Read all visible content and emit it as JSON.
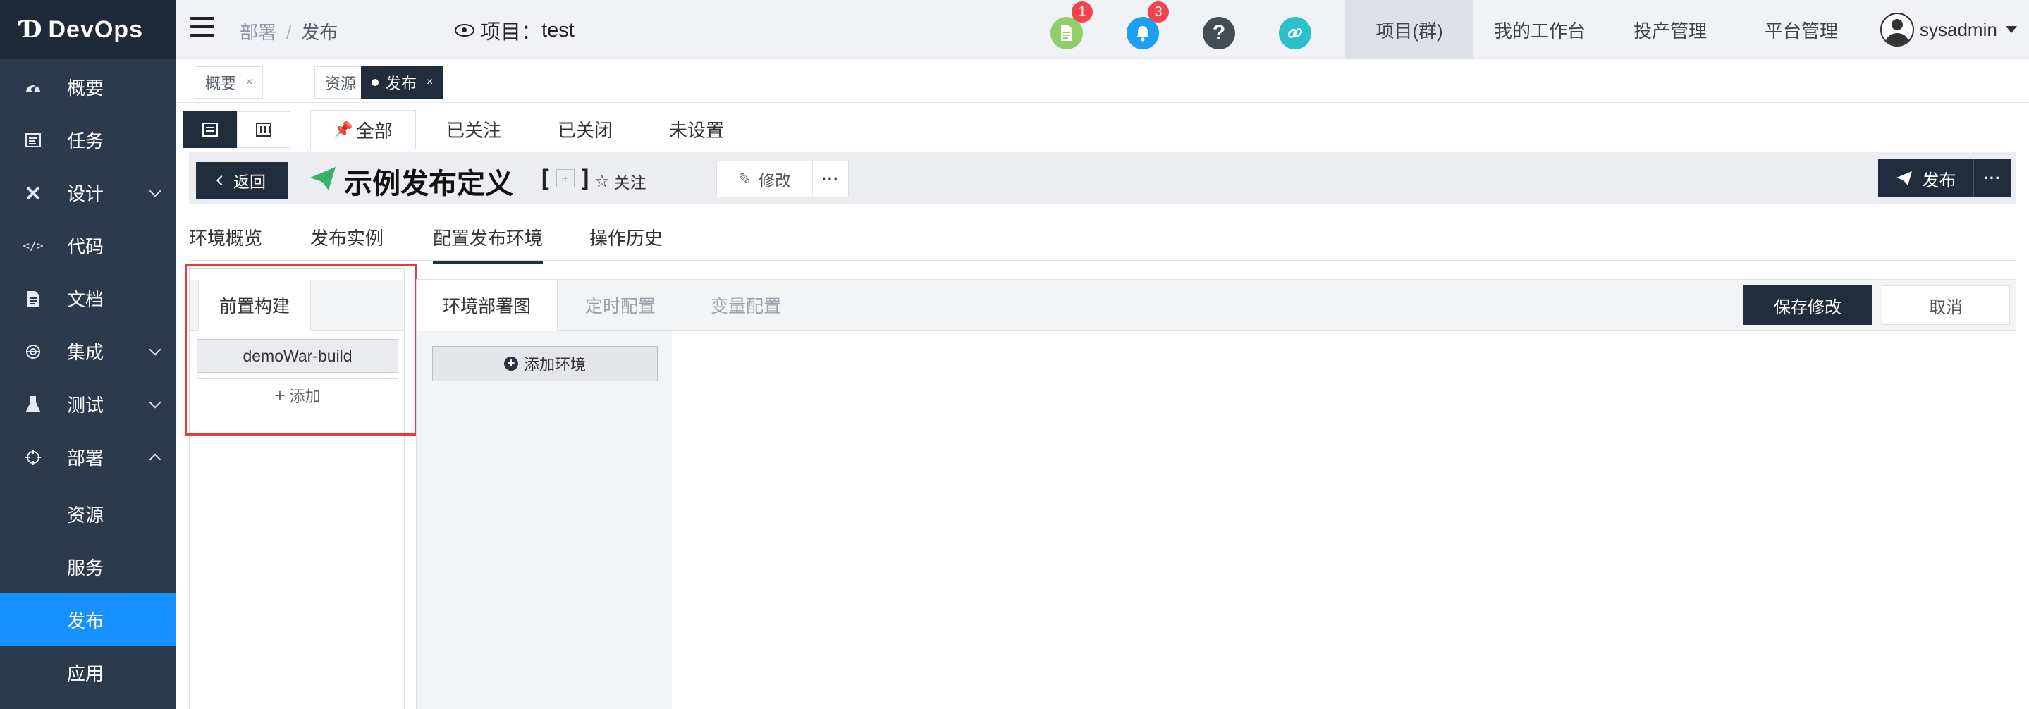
{
  "app": {
    "logo_text": "DevOps"
  },
  "sidebar": {
    "items": [
      {
        "label": "概要",
        "icon": "dashboard-icon"
      },
      {
        "label": "任务",
        "icon": "task-icon"
      },
      {
        "label": "设计",
        "icon": "design-icon",
        "expandable": true
      },
      {
        "label": "代码",
        "icon": "code-icon"
      },
      {
        "label": "文档",
        "icon": "document-icon"
      },
      {
        "label": "集成",
        "icon": "integration-icon",
        "expandable": true
      },
      {
        "label": "测试",
        "icon": "test-flask-icon",
        "expandable": true
      },
      {
        "label": "部署",
        "icon": "deploy-target-icon",
        "expanded": true
      }
    ],
    "subitems": [
      {
        "label": "资源"
      },
      {
        "label": "服务"
      },
      {
        "label": "发布",
        "active": true
      },
      {
        "label": "应用"
      }
    ]
  },
  "header": {
    "breadcrumb": [
      "部署",
      "发布"
    ],
    "breadcrumb_sep": "/",
    "project_prefix": "项目：",
    "project_name": "test",
    "icons": [
      {
        "name": "document-notice-icon",
        "color": "#8fcf6a",
        "badge": "1"
      },
      {
        "name": "bell-icon",
        "color": "#1e9ff2",
        "badge": "3"
      },
      {
        "name": "help-icon",
        "color": "#444c56",
        "glyph": "?"
      },
      {
        "name": "link-icon",
        "color": "#2bc0cc"
      }
    ],
    "menu": [
      {
        "label": "项目(群)",
        "active": true
      },
      {
        "label": "我的工作台"
      },
      {
        "label": "投产管理"
      },
      {
        "label": "平台管理"
      }
    ],
    "user": "sysadmin"
  },
  "page_tabs": [
    {
      "label": "概要"
    },
    {
      "label": "资源"
    },
    {
      "label": "发布",
      "active": true
    }
  ],
  "page_tab_close": "×",
  "filter_tabs": [
    {
      "label": "全部",
      "active": true
    },
    {
      "label": "已关注"
    },
    {
      "label": "已关闭"
    },
    {
      "label": "未设置"
    }
  ],
  "titlebar": {
    "back": "返回",
    "title": "示例发布定义",
    "bracket_open": "[",
    "bracket_plus": "+",
    "bracket_close": "]",
    "follow": "关注",
    "edit": "修改",
    "more": "···",
    "publish": "发布",
    "publish_more": "···",
    "accent_color": "#3bb26a"
  },
  "sub_tabs": [
    {
      "label": "环境概览"
    },
    {
      "label": "发布实例"
    },
    {
      "label": "配置发布环境",
      "active": true
    },
    {
      "label": "操作历史"
    }
  ],
  "left_panel": {
    "tab": "前置构建",
    "build_item": "demoWar-build",
    "add": "添加"
  },
  "right_panel": {
    "tabs": [
      {
        "label": "环境部署图",
        "active": true
      },
      {
        "label": "定时配置"
      },
      {
        "label": "变量配置"
      }
    ],
    "save": "保存修改",
    "cancel": "取消",
    "add_env": "添加环境"
  }
}
